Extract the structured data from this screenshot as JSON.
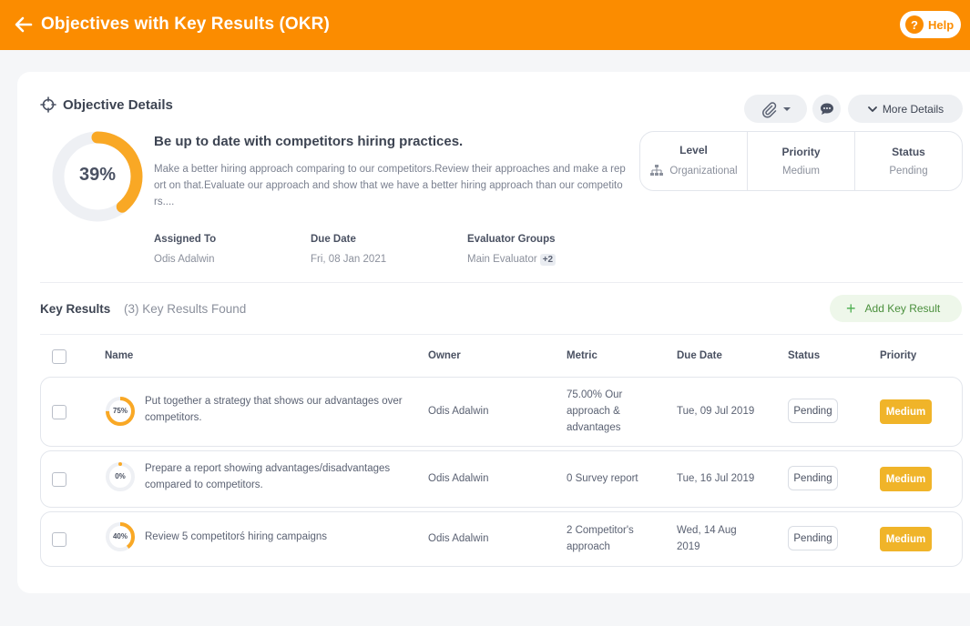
{
  "header": {
    "title": "Objectives with Key Results (OKR)",
    "help_label": "Help"
  },
  "objective": {
    "section_title": "Objective Details",
    "progress": 39,
    "progress_label": "39%",
    "title": "Be up to date with competitors hiring practices.",
    "description": "Make a better hiring approach comparing to our competitors.Review their approaches and make a report on that.Evaluate our approach and show that we have a better hiring approach than our competitors....",
    "assigned_to_label": "Assigned To",
    "assigned_to": "Odis Adalwin",
    "due_date_label": "Due Date",
    "due_date": "Fri, 08 Jan 2021",
    "evaluator_groups_label": "Evaluator Groups",
    "evaluator_groups": "Main Evaluator",
    "evaluator_extra": "+2",
    "more_details_label": "More Details",
    "level_label": "Level",
    "level": "Organizational",
    "priority_label": "Priority",
    "priority": "Medium",
    "status_label": "Status",
    "status": "Pending"
  },
  "key_results": {
    "title": "Key Results",
    "count_text": "(3) Key Results Found",
    "add_label": "Add Key Result",
    "columns": {
      "name": "Name",
      "owner": "Owner",
      "metric": "Metric",
      "due_date": "Due Date",
      "status": "Status",
      "priority": "Priority"
    },
    "rows": [
      {
        "progress": 75,
        "progress_label": "75%",
        "name": "Put together a strategy that shows our advantages over competitors.",
        "owner": "Odis Adalwin",
        "metric": "75.00% Our approach & advantages",
        "due_date": "Tue, 09 Jul 2019",
        "status": "Pending",
        "priority": "Medium"
      },
      {
        "progress": 0,
        "progress_label": "0%",
        "name": "Prepare a report showing advantages/disadvantages compared to competitors.",
        "owner": "Odis Adalwin",
        "metric": "0 Survey report",
        "due_date": "Tue, 16 Jul 2019",
        "status": "Pending",
        "priority": "Medium"
      },
      {
        "progress": 40,
        "progress_label": "40%",
        "name": "Review 5 competitorś hiring campaigns",
        "owner": "Odis Adalwin",
        "metric": "2 Competitor's approach",
        "due_date": "Wed, 14 Aug 2019",
        "status": "Pending",
        "priority": "Medium"
      }
    ]
  },
  "colors": {
    "accent": "#fb8c00",
    "ring": "#f9a825",
    "ring_track": "#eef0f4",
    "priority": "#f0b429",
    "add_green": "#4caf50"
  }
}
